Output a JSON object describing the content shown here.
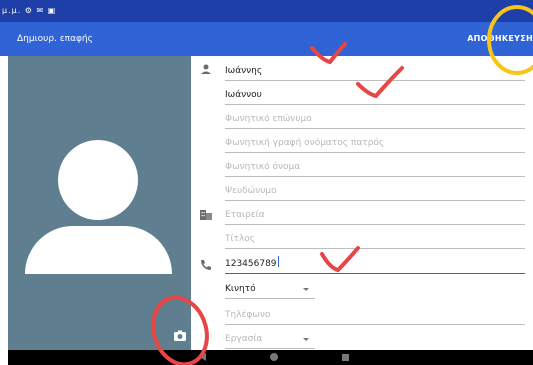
{
  "status": {
    "text": "μ.μ. ⚙ ✉ ▣"
  },
  "toolbar": {
    "title": "Δημιουρ. επαφής",
    "save": "ΑΠΟΘΗΚΕΥΣΗ"
  },
  "form": {
    "first_name": "Ιωάννης",
    "last_name": "Ιωάννου",
    "ph_phonetic_last": "Φωνητικό επώνυμο",
    "ph_phonetic_father": "Φωνητική γραφή ονόματος πατρός",
    "ph_phonetic_first": "Φωνητικό όνομα",
    "ph_nickname": "Ψευδώνυμο",
    "ph_company": "Εταιρεία",
    "ph_title": "Τίτλος",
    "phone": "123456789",
    "phone_type": "Κινητό",
    "ph_phone2": "Τηλέφωνο",
    "phone2_type": "Εργασία"
  },
  "colors": {
    "status": "#1e3ea8",
    "toolbar": "#2f63d6",
    "photo_bg": "#5f7f91",
    "annotation_red": "#e84545",
    "annotation_yellow": "#f5c518"
  }
}
